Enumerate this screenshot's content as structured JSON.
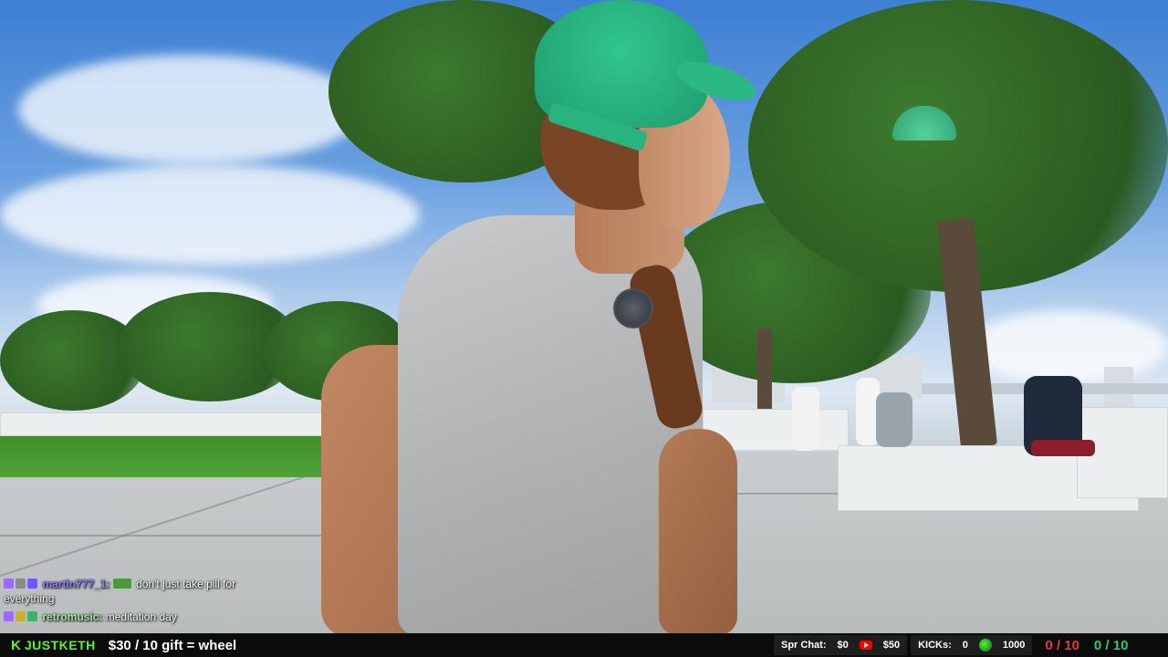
{
  "chat": {
    "messages": [
      {
        "user": "martin777_1:",
        "user_color": "#8e7cff",
        "text": "don't just take pill for everything"
      },
      {
        "user": "retromusic:",
        "user_color": "#a8e6a0",
        "text": "meditation day"
      }
    ]
  },
  "bottom_bar": {
    "brand_mark": "K",
    "brand_name": "JUSTKETH",
    "brand_color": "#53fc18",
    "goal_text": "$30 / 10 gift = wheel",
    "spr_chat_label": "Spr Chat:",
    "spr_chat_value": "$0",
    "youtube_value": "$50",
    "kicks_label": "KICKs:",
    "kicks_value": "0",
    "kick_goal_value": "1000",
    "score_red": "0 / 10",
    "score_green": "0 / 10",
    "score_red_color": "#e53935",
    "score_green_color": "#2ecc71"
  }
}
